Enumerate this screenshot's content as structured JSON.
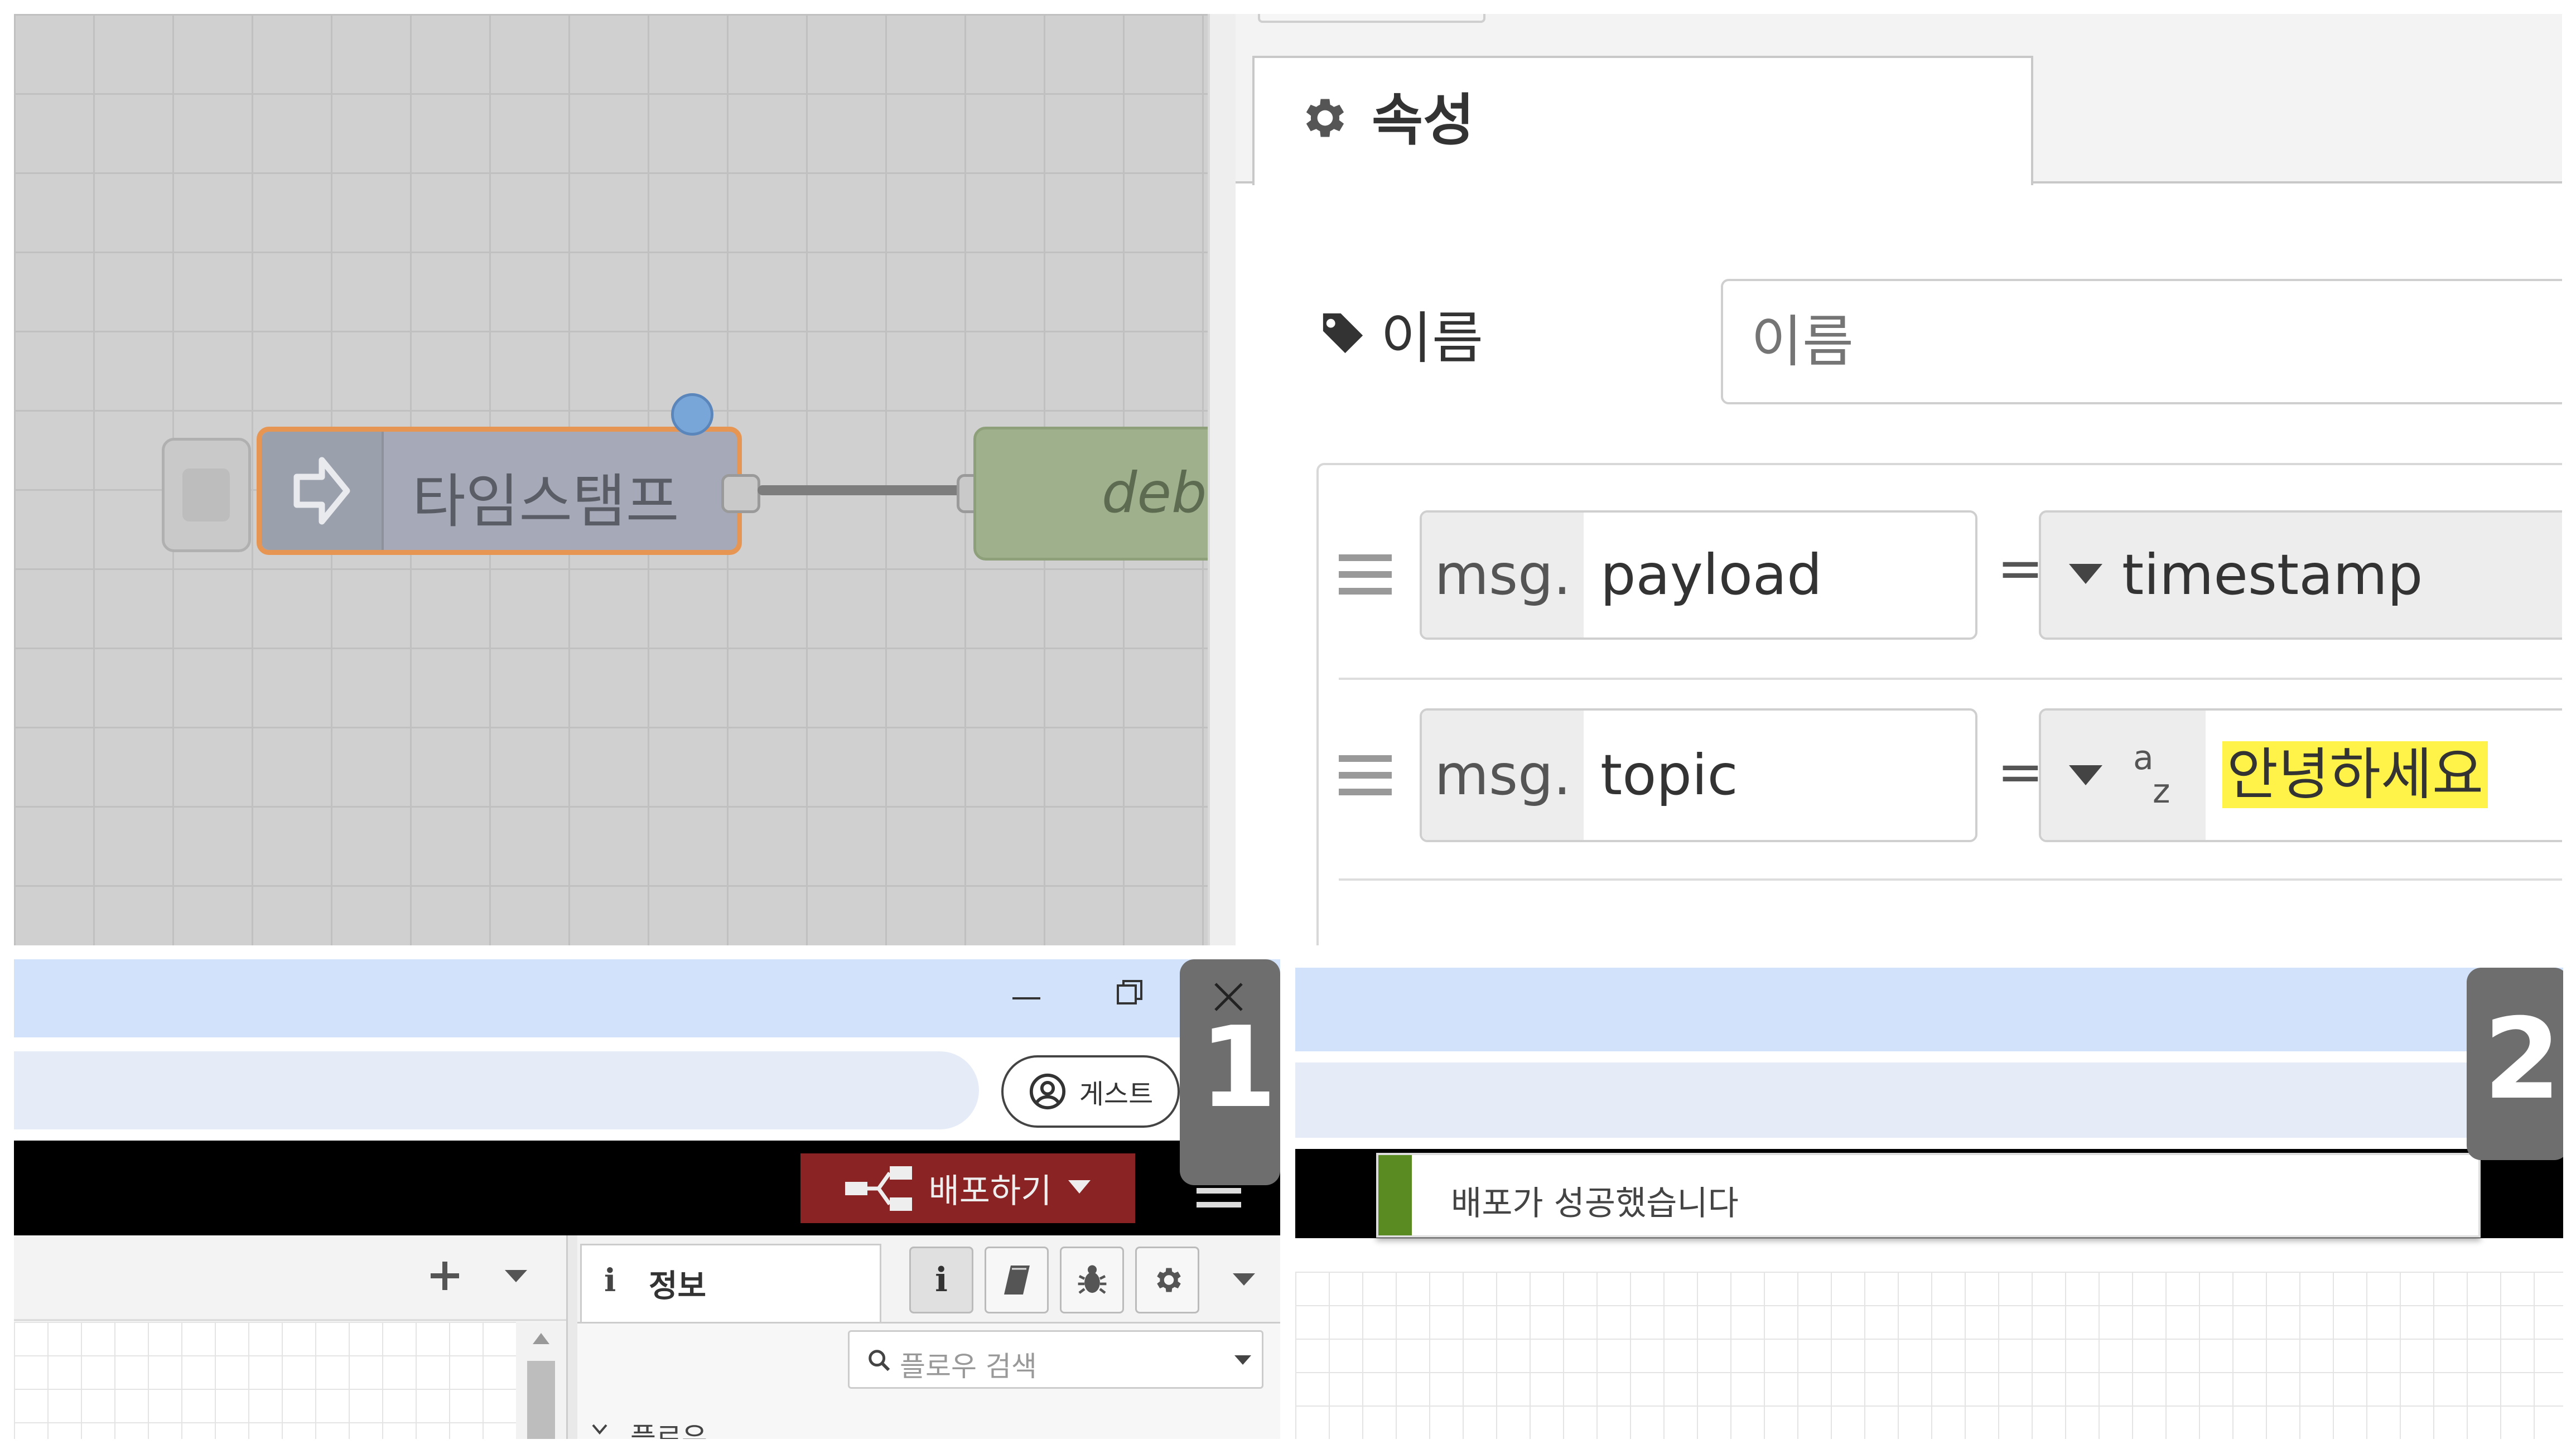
{
  "top_left_canvas": {
    "inject_node_label": "타임스탬프",
    "debug_node_label": "debu"
  },
  "properties_panel": {
    "tab_label": "속성",
    "name_field": {
      "label": "이름",
      "placeholder": "이름",
      "value": ""
    },
    "rules": [
      {
        "prefix": "msg.",
        "property": "payload",
        "operator": "=",
        "value_type": "timestamp",
        "value": ""
      },
      {
        "prefix": "msg.",
        "property": "topic",
        "operator": "=",
        "value_type_icon": "az",
        "value": "안녕하세요"
      }
    ]
  },
  "bottom_left": {
    "step_badge": "1",
    "guest_label": "게스트",
    "deploy_label": "배포하기",
    "info_tab_label": "정보",
    "flow_search_placeholder": "플로우 검색",
    "tree_item": "플로우"
  },
  "bottom_right": {
    "step_badge": "2",
    "notification": "배포가 성공했습니다"
  },
  "colors": {
    "deploy_red": "#8a2323",
    "highlight_yellow": "#fff34a",
    "success_green": "#5a8b22",
    "chrome_blue": "#d3e2fb",
    "badge_gray": "#6e6e6e"
  }
}
